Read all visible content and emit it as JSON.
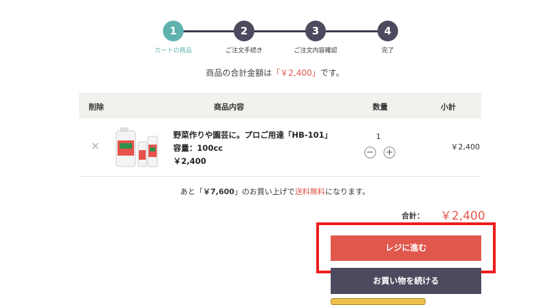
{
  "steps": [
    {
      "num": "1",
      "label": "カートの商品",
      "color": "#5fb2ad"
    },
    {
      "num": "2",
      "label": "ご注文手続き",
      "color": "#4b4a5e"
    },
    {
      "num": "3",
      "label": "ご注文内容確認",
      "color": "#4b4a5e"
    },
    {
      "num": "4",
      "label": "完了",
      "color": "#4b4a5e"
    }
  ],
  "summary": {
    "before": "商品の合計金額は",
    "amount": "「￥2,400」",
    "after": "です。"
  },
  "table": {
    "headers": {
      "delete": "削除",
      "product": "商品内容",
      "qty": "数量",
      "subtotal": "小計"
    }
  },
  "item": {
    "remove_icon": "×",
    "name": "野菜作りや園芸に。プロご用達「HB-101」",
    "capacity": "容量：100cc",
    "price": "￥2,400",
    "quantity": "1",
    "minus": "−",
    "plus": "+",
    "subtotal": "￥2,400"
  },
  "shipping": {
    "prefix": "あと「",
    "remaining": "￥7,600",
    "mid": "」のお買い上げで",
    "free": "送料無料",
    "suffix": "になります。"
  },
  "total": {
    "label": "合計：",
    "value": "￥2,400"
  },
  "buttons": {
    "checkout": "レジに進む",
    "continue": "お買い物を続ける"
  },
  "colors": {
    "accent": "#e0574c",
    "teal": "#5fb2ad",
    "dark": "#4b4a5e",
    "highlight": "#ee1c1c"
  }
}
